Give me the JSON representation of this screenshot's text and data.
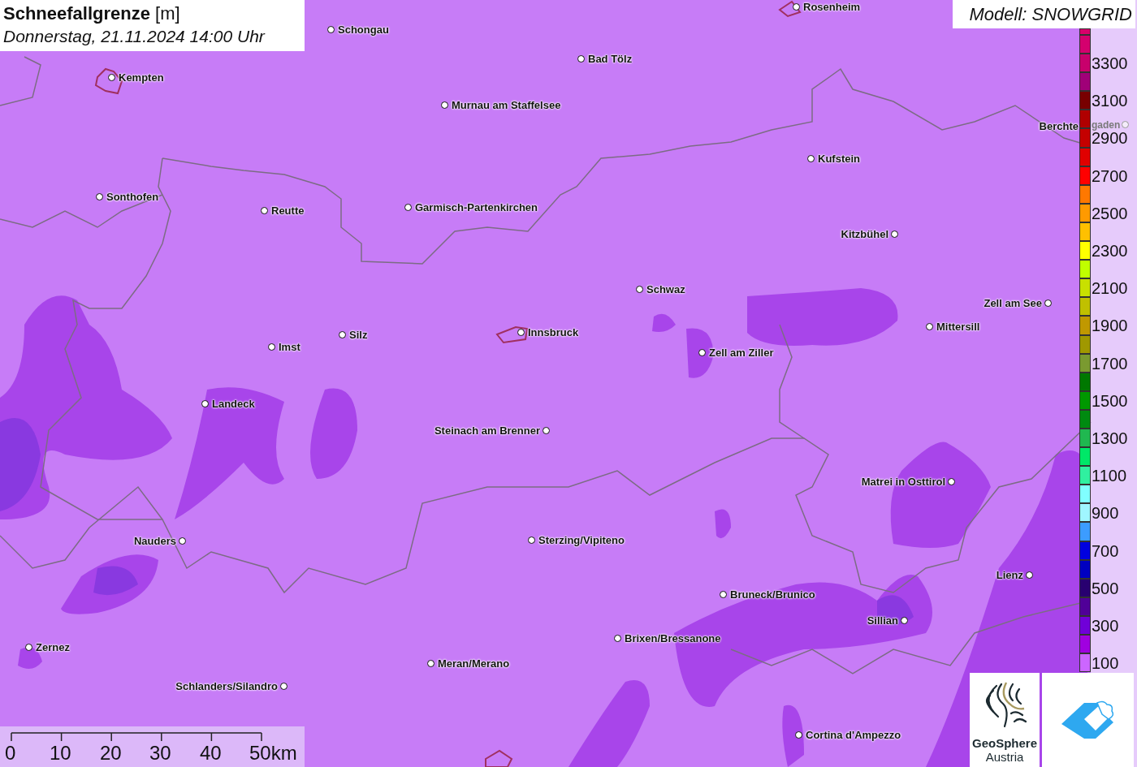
{
  "title": {
    "text": "**Schneefallgrenze** [m]",
    "subtitle": "Donnerstag, 21.11.2024 14:00 Uhr"
  },
  "model": "Modell: SNOWGRID",
  "cities": [
    {
      "name": "Rosenheim",
      "kind": "right"
    },
    {
      "name": "Schongau",
      "kind": "right"
    },
    {
      "name": "Bad Tölz",
      "kind": "right"
    },
    {
      "name": "Kempten",
      "kind": "right"
    },
    {
      "name": "Murnau am Staffelsee",
      "kind": "right"
    },
    {
      "name": "Berchte",
      "kind": "split",
      "name_continued": "gaden"
    },
    {
      "name": "Kufstein",
      "kind": "right"
    },
    {
      "name": "Sonthofen",
      "kind": "right"
    },
    {
      "name": "Reutte",
      "kind": "right"
    },
    {
      "name": "Garmisch-Partenkirchen",
      "kind": "right"
    },
    {
      "name": "Kitzbühel",
      "kind": "left"
    },
    {
      "name": "Schwaz",
      "kind": "right"
    },
    {
      "name": "Zell am See",
      "kind": "left"
    },
    {
      "name": "Mittersill",
      "kind": "right"
    },
    {
      "name": "Innsbruck",
      "kind": "right"
    },
    {
      "name": "Silz",
      "kind": "right"
    },
    {
      "name": "Imst",
      "kind": "right"
    },
    {
      "name": "Zell am Ziller",
      "kind": "right"
    },
    {
      "name": "Landeck",
      "kind": "right"
    },
    {
      "name": "Steinach am Brenner",
      "kind": "left"
    },
    {
      "name": "Matrei in Osttirol",
      "kind": "left"
    },
    {
      "name": "Nauders",
      "kind": "left"
    },
    {
      "name": "Sterzing/Vipiteno",
      "kind": "right"
    },
    {
      "name": "Lienz",
      "kind": "left"
    },
    {
      "name": "Bruneck/Brunico",
      "kind": "right"
    },
    {
      "name": "Sillian",
      "kind": "left"
    },
    {
      "name": "Brixen/Bressanone",
      "kind": "right"
    },
    {
      "name": "Zernez",
      "kind": "right"
    },
    {
      "name": "Meran/Merano",
      "kind": "right"
    },
    {
      "name": "Schlanders/Silandro",
      "kind": "left"
    },
    {
      "name": "Cortina d'Ampezzo",
      "kind": "right"
    }
  ],
  "legend": [
    {
      "color": "#d8006a"
    },
    {
      "color": "#d4006e"
    },
    {
      "color": "#c8006c",
      "label": "3300"
    },
    {
      "color": "#a00078"
    },
    {
      "color": "#780000",
      "label": "3100"
    },
    {
      "color": "#b00000"
    },
    {
      "color": "#c40000",
      "label": "2900"
    },
    {
      "color": "#e00000"
    },
    {
      "color": "#ff0000",
      "label": "2700"
    },
    {
      "color": "#ff7800"
    },
    {
      "color": "#ff9a00",
      "label": "2500"
    },
    {
      "color": "#ffc000"
    },
    {
      "color": "#ffff00",
      "label": "2300"
    },
    {
      "color": "#c0ff00"
    },
    {
      "color": "#c8e000",
      "label": "2100"
    },
    {
      "color": "#c0c000"
    },
    {
      "color": "#c09800",
      "label": "1900"
    },
    {
      "color": "#a09800"
    },
    {
      "color": "#7a9a30",
      "label": "1700"
    },
    {
      "color": "#007800"
    },
    {
      "color": "#009800",
      "label": "1500"
    },
    {
      "color": "#008a10"
    },
    {
      "color": "#20b850",
      "label": "1300"
    },
    {
      "color": "#00e868"
    },
    {
      "color": "#30f0a0",
      "label": "1100"
    },
    {
      "color": "#80ffff"
    },
    {
      "color": "#a0f6ff",
      "label": "900"
    },
    {
      "color": "#3c9cff"
    },
    {
      "color": "#0000e0",
      "label": "700"
    },
    {
      "color": "#0000c0"
    },
    {
      "color": "#280070",
      "label": "500"
    },
    {
      "color": "#500098"
    },
    {
      "color": "#7000d8",
      "label": "300"
    },
    {
      "color": "#a000e0"
    },
    {
      "color": "#cc66ff",
      "label": "100"
    }
  ],
  "scale": {
    "ticks": [
      "0",
      "10",
      "20",
      "30",
      "40",
      "50km"
    ]
  },
  "logos": {
    "geosphere": {
      "name": "GeoSphere",
      "sub": "Austria"
    }
  }
}
